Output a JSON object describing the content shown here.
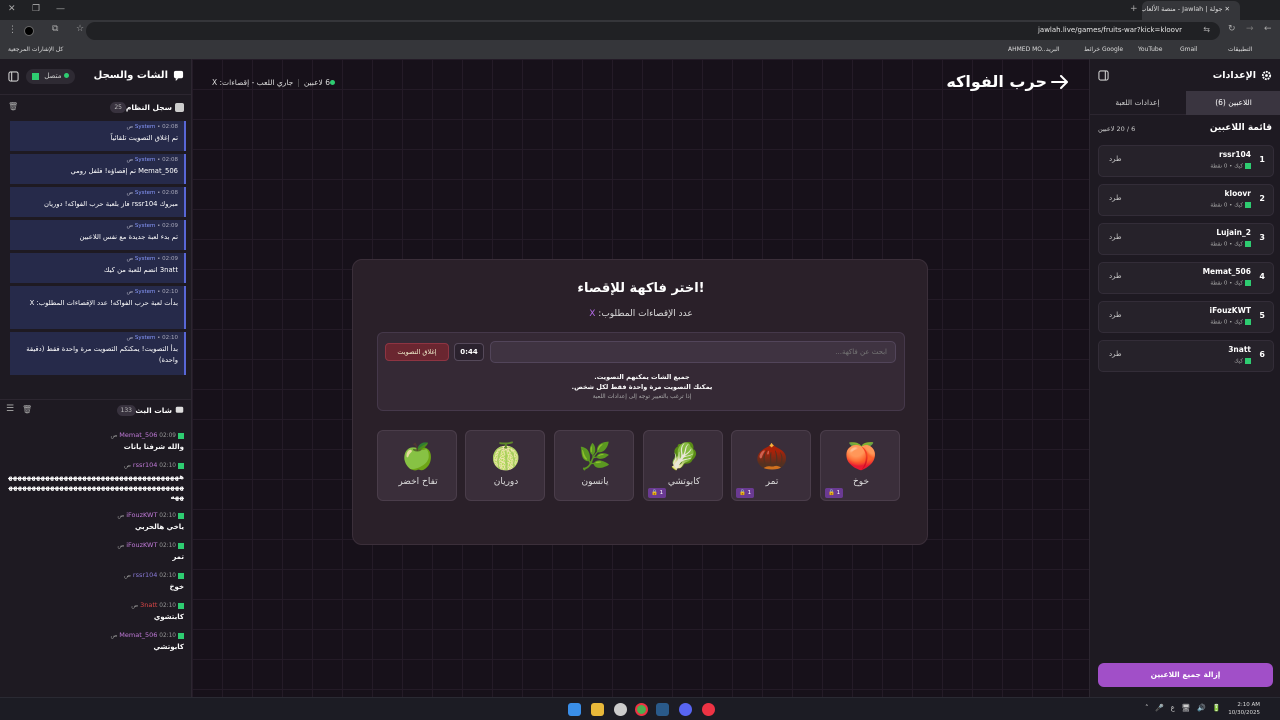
{
  "browser": {
    "tab_title": "جولة | Jawlah - منصة الألعاب الت...",
    "url": "jawlah.live/games/fruits-war?kick=kloovr",
    "bookmarks": [
      "التطبيقات",
      "Gmail",
      "YouTube",
      "خرائط Google",
      "البريد",
      "AHMED MO...",
      "كل الإشارات المرجعية"
    ]
  },
  "chat_panel": {
    "title": "الشات والسجل",
    "online_label": "متصل",
    "system_log": {
      "title": "سجل النظام",
      "count": "25",
      "messages": [
        {
          "sender": "System",
          "time": "02:08 ص",
          "text": "تم إغلاق التصويت تلقائياً"
        },
        {
          "sender": "System",
          "time": "02:08 ص",
          "text": "Memat_506 تم إقصاؤه! فلفل رومي"
        },
        {
          "sender": "System",
          "time": "02:08 ص",
          "text": "مبروك rssr104 فاز بلعبة حرب الفواكه! دوريان"
        },
        {
          "sender": "System",
          "time": "02:09 ص",
          "text": "تم بدء لعبة جديدة مع نفس اللاعبين"
        },
        {
          "sender": "System",
          "time": "02:09 ص",
          "text": "3natt انضم للعبة من كيك"
        },
        {
          "sender": "System",
          "time": "02:10 ص",
          "text": "بدأت لعبة حرب الفواكه! عدد الإقصاءات المطلوب: X"
        },
        {
          "sender": "System",
          "time": "02:10 ص",
          "text": "بدأ التصويت! يمكنكم التصويت مرة واحدة فقط (دقيقة واحدة)"
        }
      ]
    },
    "live_chat": {
      "title": "شات البث",
      "count": "133",
      "messages": [
        {
          "name": "Memat_506",
          "time": "02:09 ص",
          "text": "والله شرفنا يانات",
          "color": "purple"
        },
        {
          "name": "rssr104",
          "time": "02:10 ص",
          "text": "ههههههههههههههههههههههههههههههههههههههههههههههههههههههههههههههههههههههههههههههه",
          "color": "purple"
        },
        {
          "name": "iFouzKWT",
          "time": "02:10 ص",
          "text": "ياخي هالحربي",
          "color": "purple"
        },
        {
          "name": "iFouzKWT",
          "time": "02:10 ص",
          "text": "تمر",
          "color": "purple"
        },
        {
          "name": "rssr104",
          "time": "02:10 ص",
          "text": "خوخ",
          "color": "blue"
        },
        {
          "name": "3natt",
          "time": "02:10 ص",
          "text": "كابتشوي",
          "color": "red"
        },
        {
          "name": "Memat_506",
          "time": "02:10 ص",
          "text": "كابوتشي",
          "color": "purple"
        }
      ]
    }
  },
  "main": {
    "game_title": "حرب الفواكه",
    "status": {
      "players": "6 لاعبين",
      "state": "جاري اللعب - إقصاءات: X"
    },
    "card": {
      "title": "اختر فاكهة للإقصاء!",
      "subtitle_prefix": "عدد الإقصاءات المطلوب:",
      "subtitle_value": "X",
      "search_placeholder": "ابحث عن فاكهة...",
      "timer": "0:44",
      "close_vote_label": "إغلاق التصويت",
      "info_line1": "جميع الشات يمكنهم التصويت.",
      "info_line2": "يمكنك التصويت مرة واحدة فقط لكل شخص.",
      "info_line3": "إذا ترغب بالتغيير توجه إلى إعدادات اللعبة",
      "fruits": [
        {
          "name": "خوخ",
          "emoji": "🍑",
          "votes": "1"
        },
        {
          "name": "تمر",
          "emoji": "🌰",
          "votes": "1"
        },
        {
          "name": "كابوتشي",
          "emoji": "🥬",
          "votes": "1"
        },
        {
          "name": "يانسون",
          "emoji": "🌿",
          "votes": ""
        },
        {
          "name": "دوريان",
          "emoji": "🍈",
          "votes": ""
        },
        {
          "name": "تفاح اخضر",
          "emoji": "🍏",
          "votes": ""
        }
      ]
    }
  },
  "settings": {
    "title": "الإعدادات",
    "tab_players": "اللاعبين (6)",
    "tab_game_settings": "إعدادات اللعبة",
    "players_title": "قائمة اللاعبين",
    "players_count": "6 / 20 لاعبين",
    "kick_label": "طرد",
    "players": [
      {
        "rank": "1",
        "name": "rssr104",
        "sub": "كيك • 0 نقطة"
      },
      {
        "rank": "2",
        "name": "kloovr",
        "sub": "كيك • 0 نقطة"
      },
      {
        "rank": "3",
        "name": "Lujain_2",
        "sub": "كيك • 0 نقطة"
      },
      {
        "rank": "4",
        "name": "Memat_506",
        "sub": "كيك • 0 نقطة"
      },
      {
        "rank": "5",
        "name": "iFouzKWT",
        "sub": "كيك • 0 نقطة"
      },
      {
        "rank": "6",
        "name": "3natt",
        "sub": "كيك"
      }
    ],
    "remove_all_label": "إزالة جميع اللاعبين"
  },
  "taskbar": {
    "time": "2:10 AM",
    "date": "10/30/2025",
    "lang": "ع"
  },
  "colors": {
    "accent": "#a14fc8",
    "kick_green": "#2ecc71",
    "system_blue": "#5866d6",
    "danger": "#8e3442"
  }
}
